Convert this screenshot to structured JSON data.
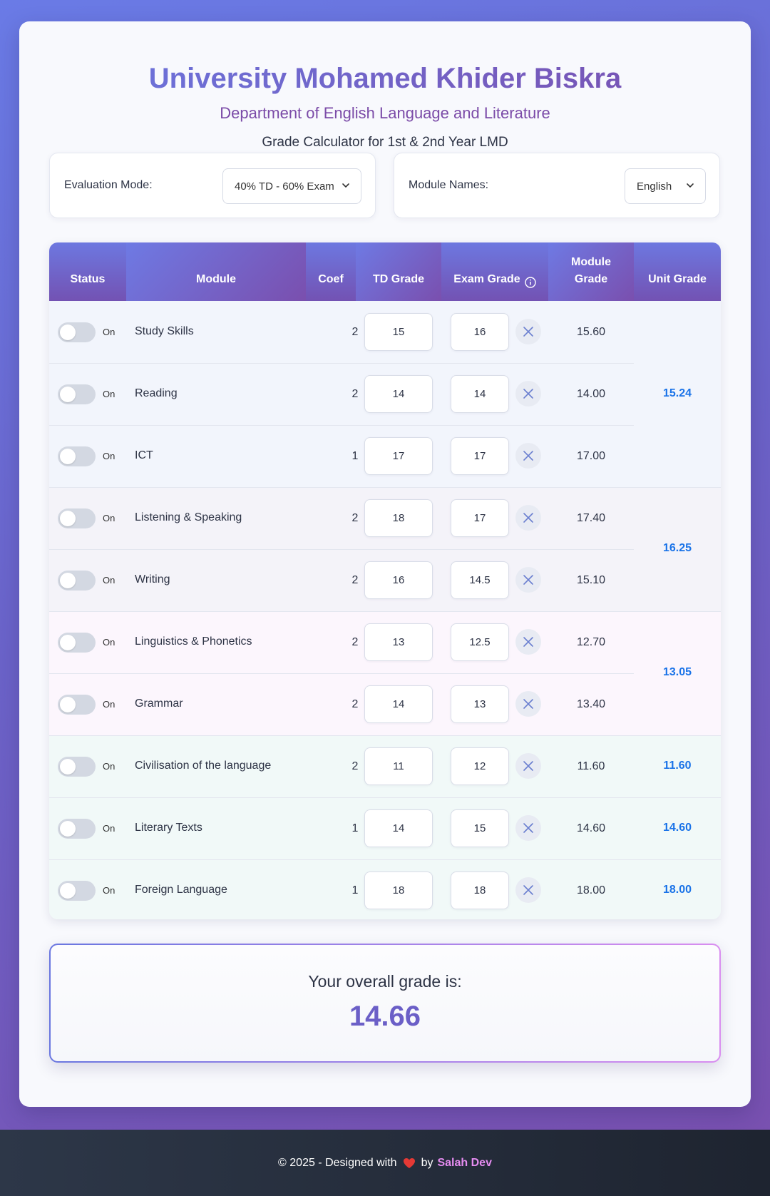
{
  "header": {
    "title": "University Mohamed Khider Biskra",
    "subtitle": "Department of English Language and Literature",
    "tagline": "Grade Calculator for 1st & 2nd Year LMD"
  },
  "options": {
    "evaluation_label": "Evaluation Mode:",
    "evaluation_value": "40% TD - 60% Exam",
    "names_label": "Module Names:",
    "names_value": "English"
  },
  "table": {
    "headers": {
      "status": "Status",
      "module": "Module",
      "coef": "Coef",
      "td": "TD Grade",
      "exam": "Exam Grade",
      "module_grade": "Module Grade",
      "unit_grade": "Unit Grade"
    },
    "toggle_label": "On",
    "rows": [
      {
        "name": "Study Skills",
        "coef": "2",
        "td": "15",
        "exam": "16",
        "module_grade": "15.60"
      },
      {
        "name": "Reading",
        "coef": "2",
        "td": "14",
        "exam": "14",
        "module_grade": "14.00"
      },
      {
        "name": "ICT",
        "coef": "1",
        "td": "17",
        "exam": "17",
        "module_grade": "17.00"
      },
      {
        "name": "Listening & Speaking",
        "coef": "2",
        "td": "18",
        "exam": "17",
        "module_grade": "17.40"
      },
      {
        "name": "Writing",
        "coef": "2",
        "td": "16",
        "exam": "14.5",
        "module_grade": "15.10"
      },
      {
        "name": "Linguistics & Phonetics",
        "coef": "2",
        "td": "13",
        "exam": "12.5",
        "module_grade": "12.70"
      },
      {
        "name": "Grammar",
        "coef": "2",
        "td": "14",
        "exam": "13",
        "module_grade": "13.40"
      },
      {
        "name": "Civilisation of the language",
        "coef": "2",
        "td": "11",
        "exam": "12",
        "module_grade": "11.60"
      },
      {
        "name": "Literary Texts",
        "coef": "1",
        "td": "14",
        "exam": "15",
        "module_grade": "14.60"
      },
      {
        "name": "Foreign Language",
        "coef": "1",
        "td": "18",
        "exam": "18",
        "module_grade": "18.00"
      }
    ],
    "units": [
      {
        "grade": "15.24",
        "color": "#f2f5fc"
      },
      {
        "grade": "16.25",
        "color": "#f4f3f9"
      },
      {
        "grade": "13.05",
        "color": "#fcf6fd"
      },
      {
        "grade": "11.60",
        "color": "#f1f9f8"
      },
      {
        "grade": "14.60",
        "color": "#f1f9f8"
      },
      {
        "grade": "18.00",
        "color": "#f1f9f8"
      }
    ]
  },
  "overall": {
    "label": "Your overall grade is:",
    "value": "14.66"
  },
  "footer": {
    "prefix": "© 2025 - Designed with",
    "by": "by",
    "author": "Salah Dev"
  }
}
